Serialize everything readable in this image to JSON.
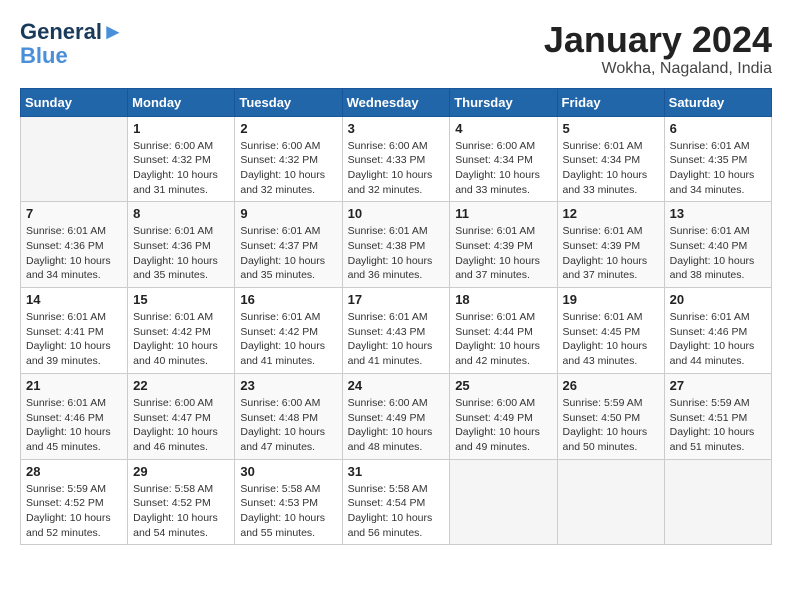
{
  "header": {
    "logo_line1": "General",
    "logo_line2": "Blue",
    "month": "January 2024",
    "location": "Wokha, Nagaland, India"
  },
  "weekdays": [
    "Sunday",
    "Monday",
    "Tuesday",
    "Wednesday",
    "Thursday",
    "Friday",
    "Saturday"
  ],
  "weeks": [
    [
      {
        "day": "",
        "info": ""
      },
      {
        "day": "1",
        "info": "Sunrise: 6:00 AM\nSunset: 4:32 PM\nDaylight: 10 hours\nand 31 minutes."
      },
      {
        "day": "2",
        "info": "Sunrise: 6:00 AM\nSunset: 4:32 PM\nDaylight: 10 hours\nand 32 minutes."
      },
      {
        "day": "3",
        "info": "Sunrise: 6:00 AM\nSunset: 4:33 PM\nDaylight: 10 hours\nand 32 minutes."
      },
      {
        "day": "4",
        "info": "Sunrise: 6:00 AM\nSunset: 4:34 PM\nDaylight: 10 hours\nand 33 minutes."
      },
      {
        "day": "5",
        "info": "Sunrise: 6:01 AM\nSunset: 4:34 PM\nDaylight: 10 hours\nand 33 minutes."
      },
      {
        "day": "6",
        "info": "Sunrise: 6:01 AM\nSunset: 4:35 PM\nDaylight: 10 hours\nand 34 minutes."
      }
    ],
    [
      {
        "day": "7",
        "info": "Sunrise: 6:01 AM\nSunset: 4:36 PM\nDaylight: 10 hours\nand 34 minutes."
      },
      {
        "day": "8",
        "info": "Sunrise: 6:01 AM\nSunset: 4:36 PM\nDaylight: 10 hours\nand 35 minutes."
      },
      {
        "day": "9",
        "info": "Sunrise: 6:01 AM\nSunset: 4:37 PM\nDaylight: 10 hours\nand 35 minutes."
      },
      {
        "day": "10",
        "info": "Sunrise: 6:01 AM\nSunset: 4:38 PM\nDaylight: 10 hours\nand 36 minutes."
      },
      {
        "day": "11",
        "info": "Sunrise: 6:01 AM\nSunset: 4:39 PM\nDaylight: 10 hours\nand 37 minutes."
      },
      {
        "day": "12",
        "info": "Sunrise: 6:01 AM\nSunset: 4:39 PM\nDaylight: 10 hours\nand 37 minutes."
      },
      {
        "day": "13",
        "info": "Sunrise: 6:01 AM\nSunset: 4:40 PM\nDaylight: 10 hours\nand 38 minutes."
      }
    ],
    [
      {
        "day": "14",
        "info": "Sunrise: 6:01 AM\nSunset: 4:41 PM\nDaylight: 10 hours\nand 39 minutes."
      },
      {
        "day": "15",
        "info": "Sunrise: 6:01 AM\nSunset: 4:42 PM\nDaylight: 10 hours\nand 40 minutes."
      },
      {
        "day": "16",
        "info": "Sunrise: 6:01 AM\nSunset: 4:42 PM\nDaylight: 10 hours\nand 41 minutes."
      },
      {
        "day": "17",
        "info": "Sunrise: 6:01 AM\nSunset: 4:43 PM\nDaylight: 10 hours\nand 41 minutes."
      },
      {
        "day": "18",
        "info": "Sunrise: 6:01 AM\nSunset: 4:44 PM\nDaylight: 10 hours\nand 42 minutes."
      },
      {
        "day": "19",
        "info": "Sunrise: 6:01 AM\nSunset: 4:45 PM\nDaylight: 10 hours\nand 43 minutes."
      },
      {
        "day": "20",
        "info": "Sunrise: 6:01 AM\nSunset: 4:46 PM\nDaylight: 10 hours\nand 44 minutes."
      }
    ],
    [
      {
        "day": "21",
        "info": "Sunrise: 6:01 AM\nSunset: 4:46 PM\nDaylight: 10 hours\nand 45 minutes."
      },
      {
        "day": "22",
        "info": "Sunrise: 6:00 AM\nSunset: 4:47 PM\nDaylight: 10 hours\nand 46 minutes."
      },
      {
        "day": "23",
        "info": "Sunrise: 6:00 AM\nSunset: 4:48 PM\nDaylight: 10 hours\nand 47 minutes."
      },
      {
        "day": "24",
        "info": "Sunrise: 6:00 AM\nSunset: 4:49 PM\nDaylight: 10 hours\nand 48 minutes."
      },
      {
        "day": "25",
        "info": "Sunrise: 6:00 AM\nSunset: 4:49 PM\nDaylight: 10 hours\nand 49 minutes."
      },
      {
        "day": "26",
        "info": "Sunrise: 5:59 AM\nSunset: 4:50 PM\nDaylight: 10 hours\nand 50 minutes."
      },
      {
        "day": "27",
        "info": "Sunrise: 5:59 AM\nSunset: 4:51 PM\nDaylight: 10 hours\nand 51 minutes."
      }
    ],
    [
      {
        "day": "28",
        "info": "Sunrise: 5:59 AM\nSunset: 4:52 PM\nDaylight: 10 hours\nand 52 minutes."
      },
      {
        "day": "29",
        "info": "Sunrise: 5:58 AM\nSunset: 4:52 PM\nDaylight: 10 hours\nand 54 minutes."
      },
      {
        "day": "30",
        "info": "Sunrise: 5:58 AM\nSunset: 4:53 PM\nDaylight: 10 hours\nand 55 minutes."
      },
      {
        "day": "31",
        "info": "Sunrise: 5:58 AM\nSunset: 4:54 PM\nDaylight: 10 hours\nand 56 minutes."
      },
      {
        "day": "",
        "info": ""
      },
      {
        "day": "",
        "info": ""
      },
      {
        "day": "",
        "info": ""
      }
    ]
  ]
}
